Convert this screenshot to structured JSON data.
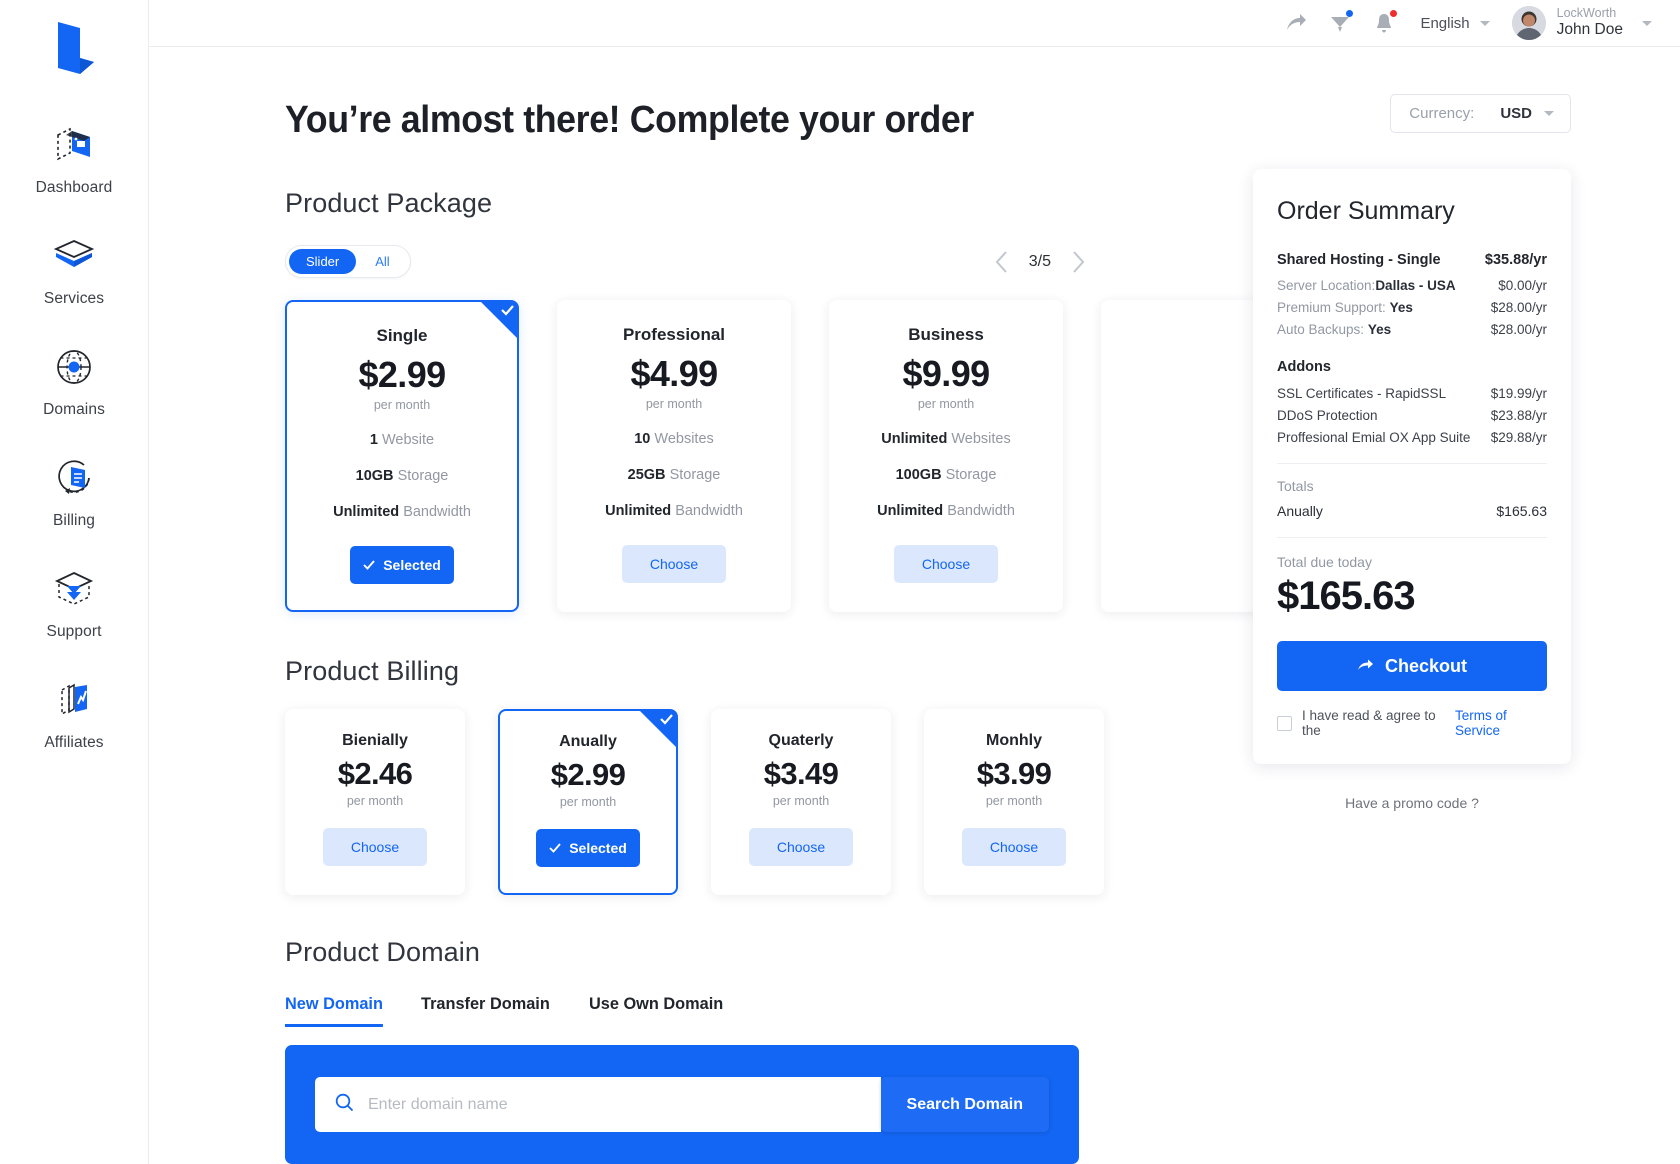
{
  "sidebar": {
    "logo_name": "lockworth-logo",
    "items": [
      {
        "label": "Dashboard",
        "icon": "dashboard-icon"
      },
      {
        "label": "Services",
        "icon": "services-box-icon"
      },
      {
        "label": "Domains",
        "icon": "globe-icon"
      },
      {
        "label": "Billing",
        "icon": "billing-document-icon"
      },
      {
        "label": "Support",
        "icon": "support-inbox-icon"
      },
      {
        "label": "Affiliates",
        "icon": "affiliates-chart-icon"
      }
    ]
  },
  "topbar": {
    "share_icon": "share-arrow-icon",
    "messages_icon": "messages-icon",
    "notifications_icon": "bell-icon",
    "language": "English",
    "user_org": "LockWorth",
    "user_name": "John Doe"
  },
  "page": {
    "title": "You’re almost there! Complete your order",
    "currency_label": "Currency:",
    "currency_value": "USD"
  },
  "package_section": {
    "title": "Product Package",
    "view_modes": [
      {
        "label": "Slider",
        "active": true
      },
      {
        "label": "All",
        "active": false
      }
    ],
    "pager": {
      "counter": "3/5",
      "prev_icon": "chevron-left-icon",
      "next_icon": "chevron-right-icon"
    },
    "cards": [
      {
        "name": "Single",
        "price": "$2.99",
        "period": "per month",
        "features": [
          {
            "value": "1",
            "label": "Website"
          },
          {
            "value": "10GB",
            "label": "Storage"
          },
          {
            "value": "Unlimited",
            "label": "Bandwidth"
          }
        ],
        "button": "Selected",
        "selected": true
      },
      {
        "name": "Professional",
        "price": "$4.99",
        "period": "per month",
        "features": [
          {
            "value": "10",
            "label": "Websites"
          },
          {
            "value": "25GB",
            "label": "Storage"
          },
          {
            "value": "Unlimited",
            "label": "Bandwidth"
          }
        ],
        "button": "Choose",
        "selected": false
      },
      {
        "name": "Business",
        "price": "$9.99",
        "period": "per month",
        "features": [
          {
            "value": "Unlimited",
            "label": "Websites"
          },
          {
            "value": "100GB",
            "label": "Storage"
          },
          {
            "value": "Unlimited",
            "label": "Bandwidth"
          }
        ],
        "button": "Choose",
        "selected": false
      },
      {
        "name": "",
        "price": "",
        "period": "",
        "features": [],
        "button": "",
        "selected": false
      }
    ]
  },
  "billing_section": {
    "title": "Product Billing",
    "cards": [
      {
        "name": "Bienially",
        "price": "$2.46",
        "period": "per month",
        "button": "Choose",
        "selected": false
      },
      {
        "name": "Anually",
        "price": "$2.99",
        "period": "per month",
        "button": "Selected",
        "selected": true
      },
      {
        "name": "Quaterly",
        "price": "$3.49",
        "period": "per month",
        "button": "Choose",
        "selected": false
      },
      {
        "name": "Monhly",
        "price": "$3.99",
        "period": "per month",
        "button": "Choose",
        "selected": false
      }
    ]
  },
  "domain_section": {
    "title": "Product Domain",
    "tabs": [
      {
        "label": "New Domain",
        "active": true
      },
      {
        "label": "Transfer Domain",
        "active": false
      },
      {
        "label": "Use Own Domain",
        "active": false
      }
    ],
    "search_placeholder": "Enter domain name",
    "search_value": "",
    "search_button": "Search Domain",
    "search_icon": "search-icon"
  },
  "order_summary": {
    "title": "Order Summary",
    "product": {
      "label": "Shared Hosting - Single",
      "amount": "$35.88/yr"
    },
    "product_options": [
      {
        "label": "Server Location:",
        "value": "Dallas - USA",
        "amount": "$0.00/yr"
      },
      {
        "label": "Premium Support:",
        "value": "Yes",
        "amount": "$28.00/yr"
      },
      {
        "label": "Auto Backups:",
        "value": "Yes",
        "amount": "$28.00/yr"
      }
    ],
    "addons_title": "Addons",
    "addons": [
      {
        "label": "SSL Certificates - RapidSSL",
        "amount": "$19.99/yr"
      },
      {
        "label": "DDoS Protection",
        "amount": "$23.88/yr"
      },
      {
        "label": "Proffesional Emial  OX App Suite",
        "amount": "$29.88/yr"
      }
    ],
    "totals_label": "Totals",
    "total_cycle": "Anually",
    "total_cycle_amount": "$165.63",
    "due_label": "Total due today",
    "due_amount": "$165.63",
    "checkout_label": "Checkout",
    "checkout_icon": "arrow-right-icon",
    "tos_text": "I have read & agree to the",
    "tos_link": "Terms of Service",
    "promo_text": "Have a promo code ?"
  },
  "colors": {
    "accent": "#1366f3",
    "accent_soft": "#dbe7fd",
    "text": "#2d3139",
    "muted": "#9298a2",
    "notification_red": "#f02c2c",
    "notification_blue": "#1366f3"
  }
}
